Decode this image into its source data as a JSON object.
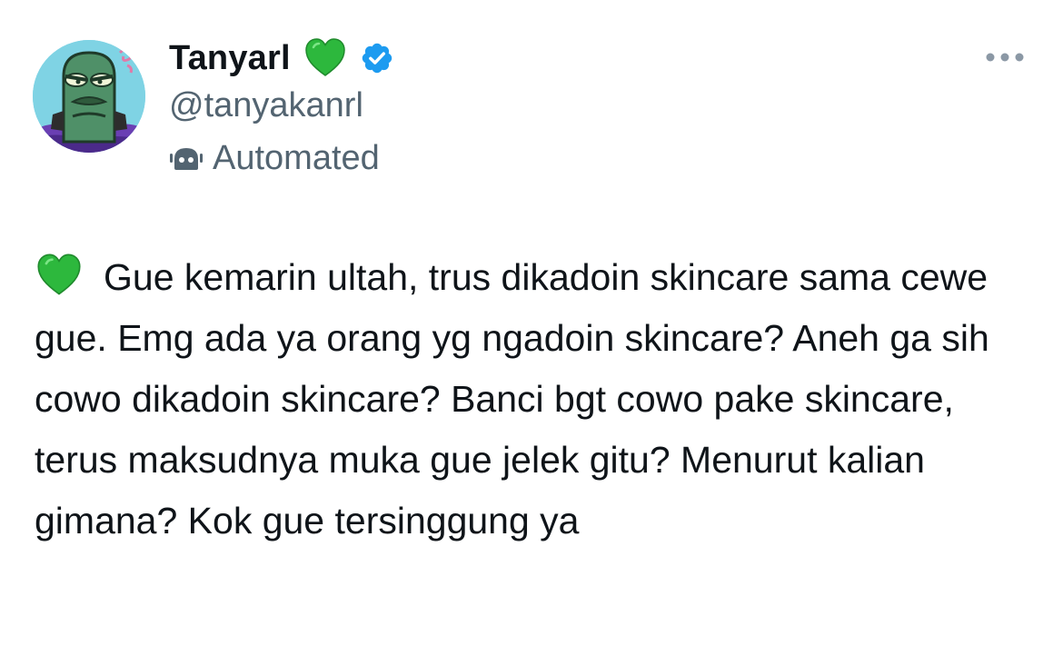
{
  "tweet": {
    "author": {
      "display_name": "Tanyarl",
      "handle": "@tanyakanrl",
      "label": "Automated",
      "avatar_icon": "spongebob-fish-avatar",
      "name_emoji": "green-heart-icon",
      "verified": true
    },
    "more_icon": "more-horizontal-icon",
    "body_emoji": "green-heart-icon",
    "text": "Gue kemarin ultah, trus dikadoin skincare sama cewe gue. Emg ada ya orang yg ngadoin skincare? Aneh ga sih cowo dikadoin skincare? Banci bgt cowo pake skincare, terus maksudnya muka gue jelek gitu? Menurut kalian gimana? Kok gue tersinggung ya"
  },
  "colors": {
    "primary_text": "#0f1419",
    "secondary_text": "#536471",
    "verified_blue": "#1d9bf0",
    "heart_green": "#2db83d"
  }
}
